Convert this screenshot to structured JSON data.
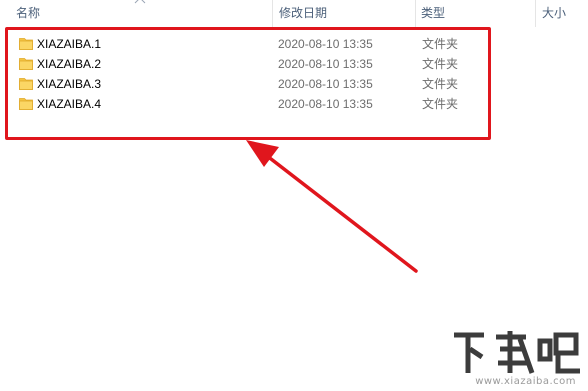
{
  "header": {
    "columns": {
      "name": "名称",
      "date_modified": "修改日期",
      "type": "类型",
      "size": "大小"
    }
  },
  "files": [
    {
      "name": "XIAZAIBA.1",
      "date": "2020-08-10 13:35",
      "type": "文件夹"
    },
    {
      "name": "XIAZAIBA.2",
      "date": "2020-08-10 13:35",
      "type": "文件夹"
    },
    {
      "name": "XIAZAIBA.3",
      "date": "2020-08-10 13:35",
      "type": "文件夹"
    },
    {
      "name": "XIAZAIBA.4",
      "date": "2020-08-10 13:35",
      "type": "文件夹"
    }
  ],
  "icons": {
    "folder": "folder-icon",
    "sort": "sort-caret-icon"
  },
  "annotation": {
    "highlight_color": "#e0161d",
    "arrow_color": "#e0161d"
  },
  "watermark": {
    "logo_text": "下载吧",
    "url_text": "www.xiazaiba.com"
  },
  "colors": {
    "header_text": "#4c607a",
    "folder_yellow": "#f5c443",
    "secondary_text": "#6d6d6d"
  }
}
